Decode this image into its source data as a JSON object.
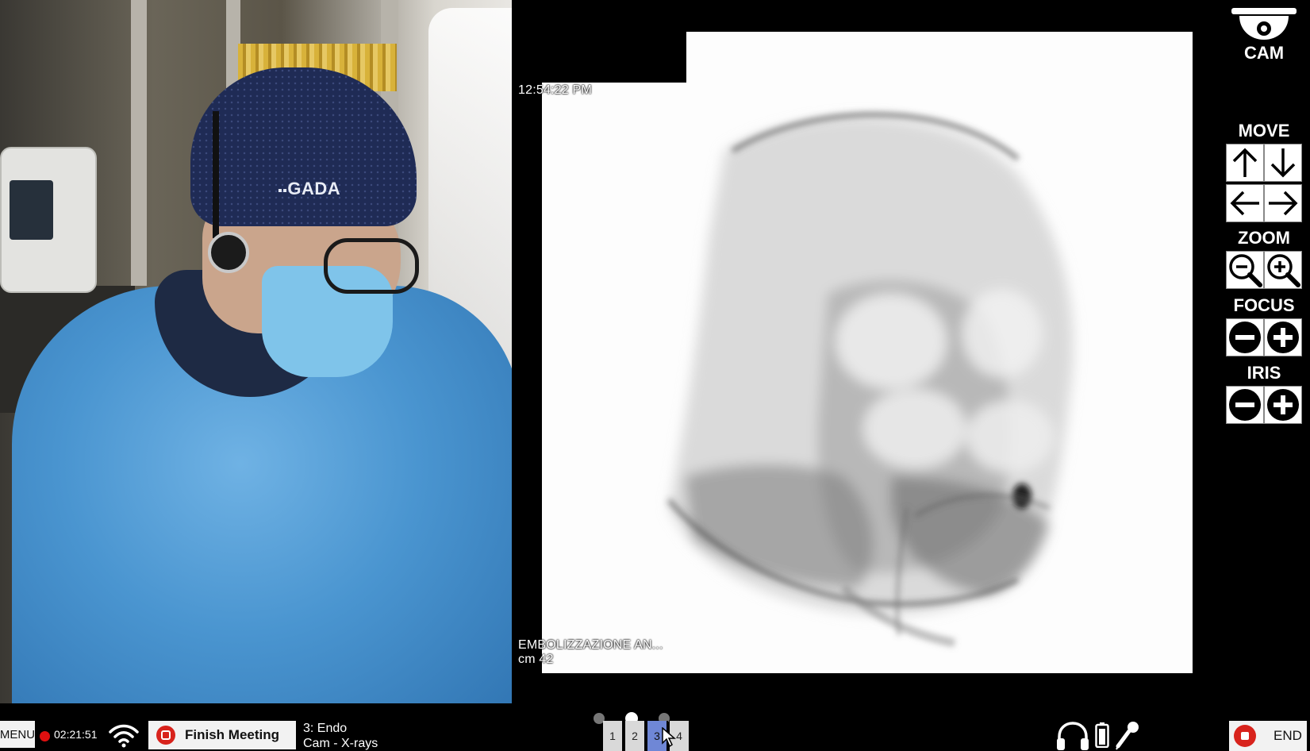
{
  "xray": {
    "timestamp": "12:54:22 PM",
    "procedure_line1": "EMBOLIZZAZIONE AN...",
    "procedure_line2": "cm 42"
  },
  "camera_feed": {
    "cap_logo_text": "GADA"
  },
  "controls": {
    "cam_label": "CAM",
    "move_title": "MOVE",
    "zoom_title": "ZOOM",
    "focus_title": "FOCUS",
    "iris_title": "IRIS"
  },
  "toolbar": {
    "menu_label": "MENU",
    "timer": "02:21:51",
    "finish_label": "Finish Meeting",
    "layout_line1": "3: Endo",
    "layout_line2": "Cam - X-rays",
    "layout_tabs": [
      "1",
      "2",
      "3",
      "4"
    ],
    "active_tab": "3",
    "active_page_dot": 2,
    "end_label": "END"
  },
  "colors": {
    "record_red": "#e01010",
    "active_tab": "#6f87d6",
    "button_bg": "#f2f2f2"
  },
  "icons": [
    "camera-dome-icon",
    "arrow-up-icon",
    "arrow-down-icon",
    "arrow-left-icon",
    "arrow-right-icon",
    "zoom-out-icon",
    "zoom-in-icon",
    "minus-icon",
    "plus-icon",
    "wifi-icon",
    "headphones-icon",
    "battery-icon",
    "microphone-icon",
    "stop-icon",
    "mouse-cursor-icon"
  ]
}
